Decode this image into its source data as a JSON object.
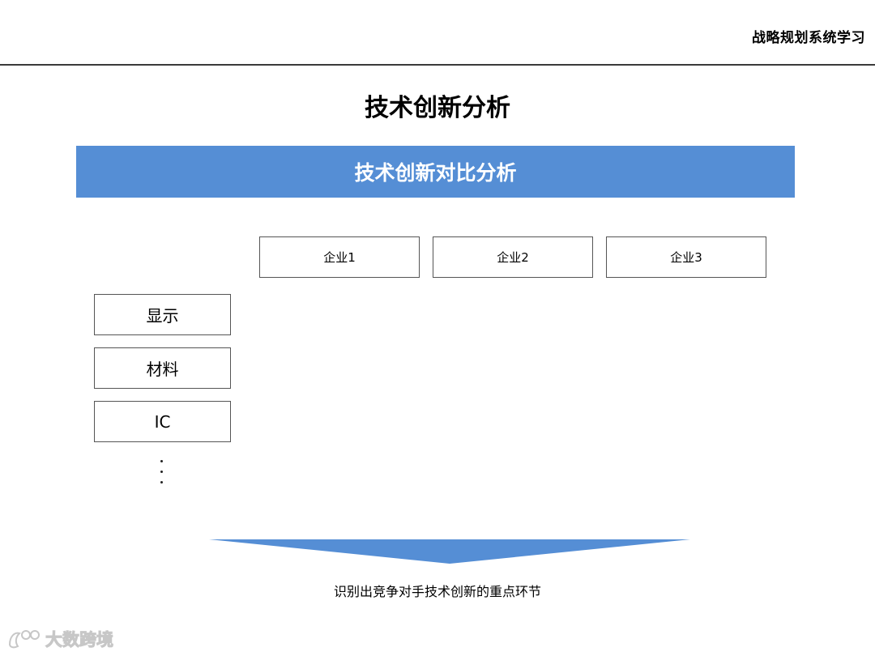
{
  "header": {
    "title": "战略规划系统学习"
  },
  "slide": {
    "title": "技术创新分析",
    "banner": "技术创新对比分析",
    "columns": [
      "企业1",
      "企业2",
      "企业3"
    ],
    "rows": [
      "显示",
      "材料",
      "IC"
    ],
    "conclusion": "识别出竞争对手技术创新的重点环节"
  },
  "watermark": {
    "text": "大数跨境",
    "icon": "brand-logo-icon"
  },
  "colors": {
    "accent": "#558ed5",
    "rule": "#3a3a3a",
    "box_border": "#555555"
  }
}
